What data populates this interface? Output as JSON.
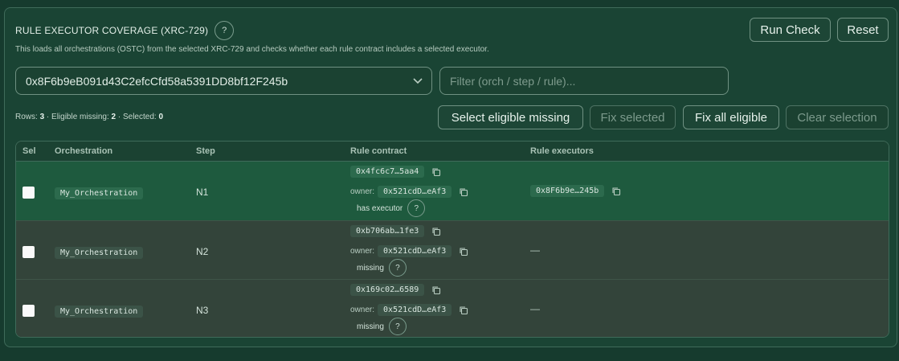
{
  "header": {
    "title": "RULE EXECUTOR COVERAGE (XRC-729)",
    "help": "?",
    "subtitle": "This loads all orchestrations (OSTC) from the selected XRC-729 and checks whether each rule contract includes a selected executor."
  },
  "actions": {
    "run_check": "Run Check",
    "reset": "Reset",
    "select_eligible_missing": "Select eligible missing",
    "fix_selected": "Fix selected",
    "fix_all_eligible": "Fix all eligible",
    "clear_selection": "Clear selection"
  },
  "address_select": {
    "value": "0x8F6b9eB091d43C2efcCfd58a5391DD8bf12F245b"
  },
  "filter": {
    "placeholder": "Filter (orch / step / rule)...",
    "value": ""
  },
  "stats": {
    "rows_label": "Rows:",
    "rows": "3",
    "eligible_label": "· Eligible missing:",
    "eligible": "2",
    "selected_label": "· Selected:",
    "selected": "0"
  },
  "table": {
    "columns": [
      "Sel",
      "Orchestration",
      "Step",
      "Rule contract",
      "Rule executors"
    ],
    "owner_label": "owner:",
    "rows": [
      {
        "orchestration": "My_Orchestration",
        "step": "N1",
        "contract": "0x4fc6c7…5aa4",
        "owner": "0x521cdD…eAf3",
        "status": "has executor",
        "executor": "0x8F6b9e…245b",
        "selected": false
      },
      {
        "orchestration": "My_Orchestration",
        "step": "N2",
        "contract": "0xb706ab…1fe3",
        "owner": "0x521cdD…eAf3",
        "status": "missing",
        "executor": "—",
        "selected": false
      },
      {
        "orchestration": "My_Orchestration",
        "step": "N3",
        "contract": "0x169c02…6589",
        "owner": "0x521cdD…eAf3",
        "status": "missing",
        "executor": "—",
        "selected": false
      }
    ]
  },
  "icons": {
    "copy": "copy-icon",
    "chevron": "chevron-down-icon",
    "help": "help-icon"
  },
  "colors": {
    "background": "#163b2e",
    "panel": "#1a4434",
    "row_ok": "#1e5a3e",
    "row_missing": "#33443a",
    "border": "#3f6b5a"
  }
}
